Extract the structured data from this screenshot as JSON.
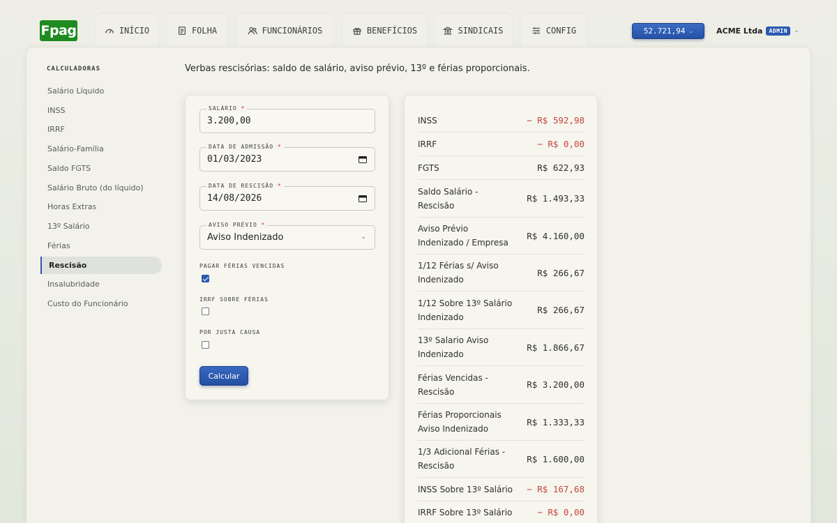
{
  "logo": "Fpag",
  "tabs": [
    {
      "label": "INÍCIO",
      "icon": "gauge-icon"
    },
    {
      "label": "FOLHA",
      "icon": "document-icon"
    },
    {
      "label": "FUNCIONÁRIOS",
      "icon": "users-icon"
    },
    {
      "label": "BENEFÍCIOS",
      "icon": "gift-icon"
    },
    {
      "label": "SINDICAIS",
      "icon": "bank-icon"
    },
    {
      "label": "CONFIG",
      "icon": "sliders-icon"
    }
  ],
  "header": {
    "balance": "52.721,94",
    "company": "ACME Ltda",
    "role_badge": "ADMIN"
  },
  "sidebar": {
    "title": "CALCULADORAS",
    "items": [
      {
        "label": "Salário Líquido"
      },
      {
        "label": "INSS"
      },
      {
        "label": "IRRF"
      },
      {
        "label": "Salário-Família"
      },
      {
        "label": "Saldo FGTS"
      },
      {
        "label": "Salário Bruto (do líquido)"
      },
      {
        "label": "Horas Extras"
      },
      {
        "label": "13º Salário"
      },
      {
        "label": "Férias"
      },
      {
        "label": "Rescisão",
        "active": true
      },
      {
        "label": "Insalubridade"
      },
      {
        "label": "Custo do Funcionário"
      }
    ]
  },
  "page": {
    "subtitle": "Verbas rescisórias: saldo de salário, aviso prévio, 13º e férias proporcionais."
  },
  "form": {
    "salario": {
      "label": "SALÁRIO",
      "value": "3.200,00"
    },
    "admissao": {
      "label": "DATA DE ADMISSÃO",
      "value": "01/03/2023"
    },
    "rescisao": {
      "label": "DATA DE RESCISÃO",
      "value": "14/08/2026"
    },
    "aviso": {
      "label": "AVISO PRÉVIO",
      "value": "Aviso Indenizado"
    },
    "ferias_vencidas": {
      "label": "PAGAR FÉRIAS VENCIDAS",
      "checked": true
    },
    "irrf_ferias": {
      "label": "IRRF SOBRE FÉRIAS",
      "checked": false
    },
    "justa_causa": {
      "label": "POR JUSTA CAUSA",
      "checked": false
    },
    "required_mark": "*",
    "submit_label": "Calcular"
  },
  "results": [
    {
      "label": "INSS",
      "value": "− R$ 592,98",
      "negative": true
    },
    {
      "label": "IRRF",
      "value": "− R$ 0,00",
      "negative": true
    },
    {
      "label": "FGTS",
      "value": "R$ 622,93"
    },
    {
      "label": "Saldo Salário - Rescisão",
      "value": "R$ 1.493,33"
    },
    {
      "label": "Aviso Prévio Indenizado / Empresa",
      "value": "R$ 4.160,00"
    },
    {
      "label": "1/12 Férias s/ Aviso Indenizado",
      "value": "R$ 266,67"
    },
    {
      "label": "1/12 Sobre 13º Salário Indenizado",
      "value": "R$ 266,67"
    },
    {
      "label": "13º Salario Aviso Indenizado",
      "value": "R$ 1.866,67"
    },
    {
      "label": "Férias Vencidas - Rescisão",
      "value": "R$ 3.200,00"
    },
    {
      "label": "Férias Proporcionais Aviso Indenizado",
      "value": "R$ 1.333,33"
    },
    {
      "label": "1/3 Adicional Férias - Rescisão",
      "value": "R$ 1.600,00"
    },
    {
      "label": "INSS Sobre 13º Salário",
      "value": "− R$ 167,68",
      "negative": true
    },
    {
      "label": "IRRF Sobre 13º Salário",
      "value": "− R$ 0,00",
      "negative": true
    }
  ]
}
